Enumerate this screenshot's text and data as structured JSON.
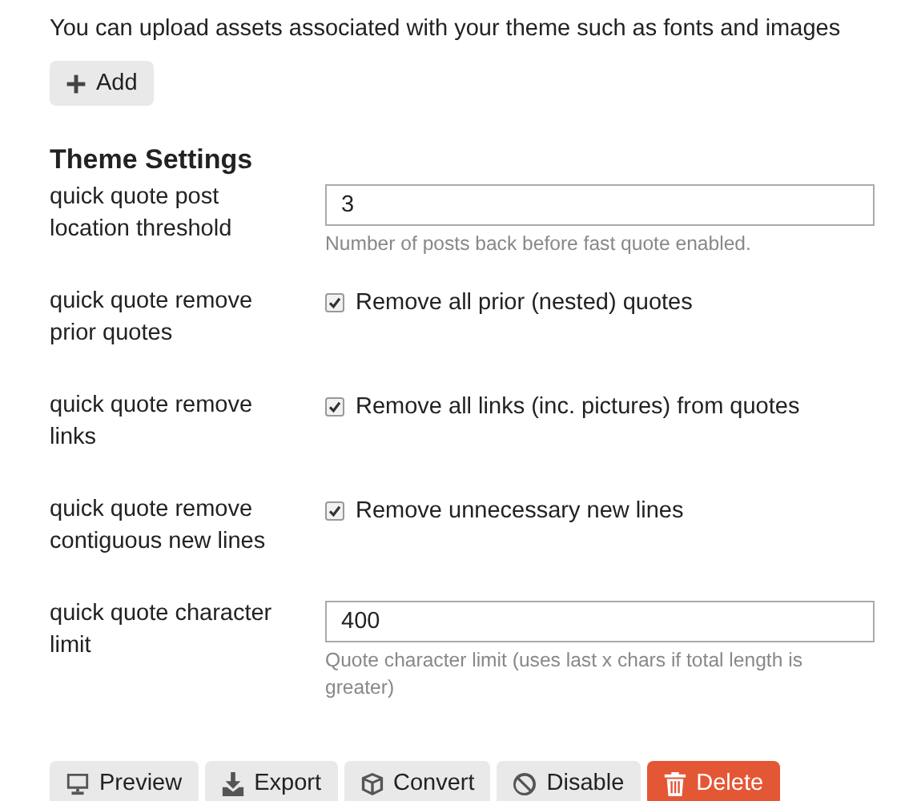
{
  "intro": "You can upload assets associated with your theme such as fonts and images",
  "add_button": {
    "label": "Add"
  },
  "section_title": "Theme Settings",
  "settings": [
    {
      "kind": "text",
      "label": "quick quote post location threshold",
      "value": "3",
      "description": "Number of posts back before fast quote enabled."
    },
    {
      "kind": "checkbox",
      "label": "quick quote remove prior quotes",
      "checked": true,
      "description": "Remove all prior (nested) quotes"
    },
    {
      "kind": "checkbox",
      "label": "quick quote remove links",
      "checked": true,
      "description": "Remove all links (inc. pictures) from quotes"
    },
    {
      "kind": "checkbox",
      "label": "quick quote remove contiguous new lines",
      "checked": true,
      "description": "Remove unnecessary new lines"
    },
    {
      "kind": "text",
      "label": "quick quote character limit",
      "value": "400",
      "description": "Quote character limit (uses last x chars if total length is greater)"
    }
  ],
  "buttons": [
    {
      "kind": "preview",
      "label": "Preview",
      "danger": false
    },
    {
      "kind": "export",
      "label": "Export",
      "danger": false
    },
    {
      "kind": "convert",
      "label": "Convert",
      "danger": false
    },
    {
      "kind": "disable",
      "label": "Disable",
      "danger": false
    },
    {
      "kind": "delete",
      "label": "Delete",
      "danger": true
    }
  ]
}
